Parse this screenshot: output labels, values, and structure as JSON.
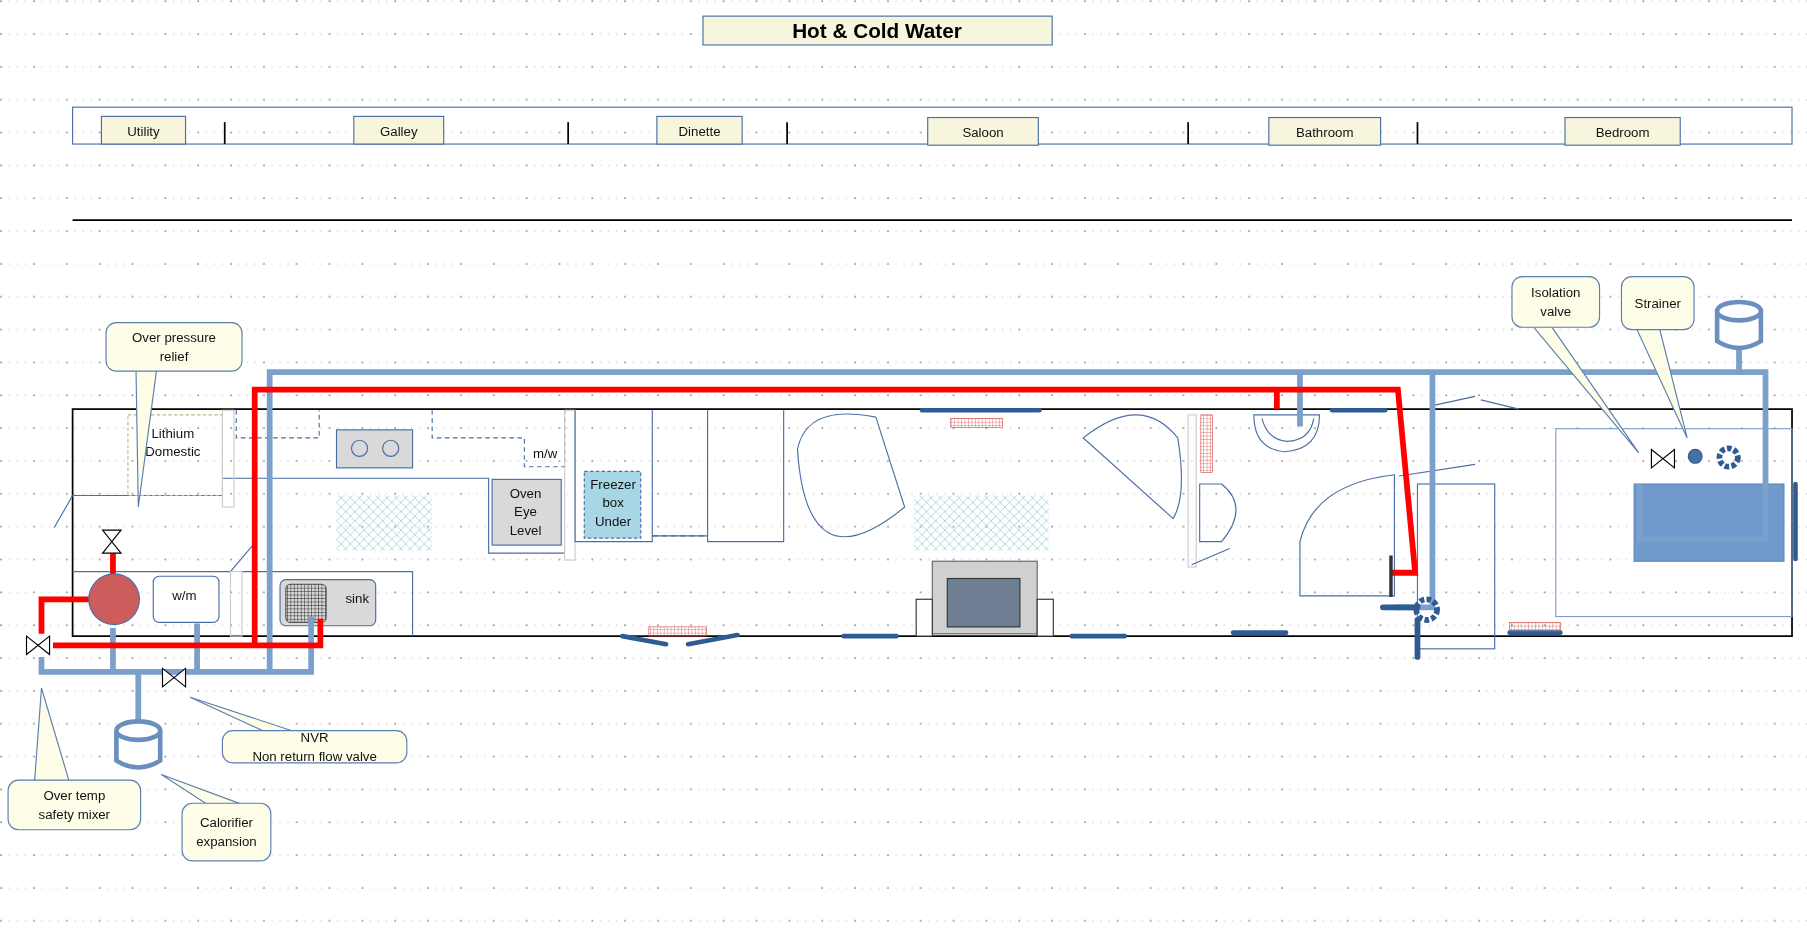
{
  "title": "Hot & Cold Water",
  "rooms": [
    {
      "label": "Utility"
    },
    {
      "label": "Galley"
    },
    {
      "label": "Dinette"
    },
    {
      "label": "Saloon"
    },
    {
      "label": "Bathroom"
    },
    {
      "label": "Bedroom"
    }
  ],
  "fixture_labels": [
    {
      "lines": [
        "Lithium",
        "Domestic"
      ]
    },
    {
      "lines": [
        "m/w"
      ]
    },
    {
      "lines": [
        "Oven",
        "Eye",
        "Level"
      ]
    },
    {
      "lines": [
        "Freezer",
        "box",
        "Under"
      ]
    },
    {
      "lines": [
        "w/m"
      ]
    },
    {
      "lines": [
        "sink"
      ]
    }
  ],
  "callouts": [
    {
      "lines": [
        "Over pressure",
        "relief"
      ]
    },
    {
      "lines": [
        "Over temp",
        "safety mixer"
      ]
    },
    {
      "lines": [
        "Calorifier",
        "expansion"
      ]
    },
    {
      "lines": [
        "NVR",
        "Non return flow valve"
      ]
    },
    {
      "lines": [
        "Isolation",
        "valve"
      ]
    },
    {
      "lines": [
        "Strainer"
      ]
    }
  ]
}
